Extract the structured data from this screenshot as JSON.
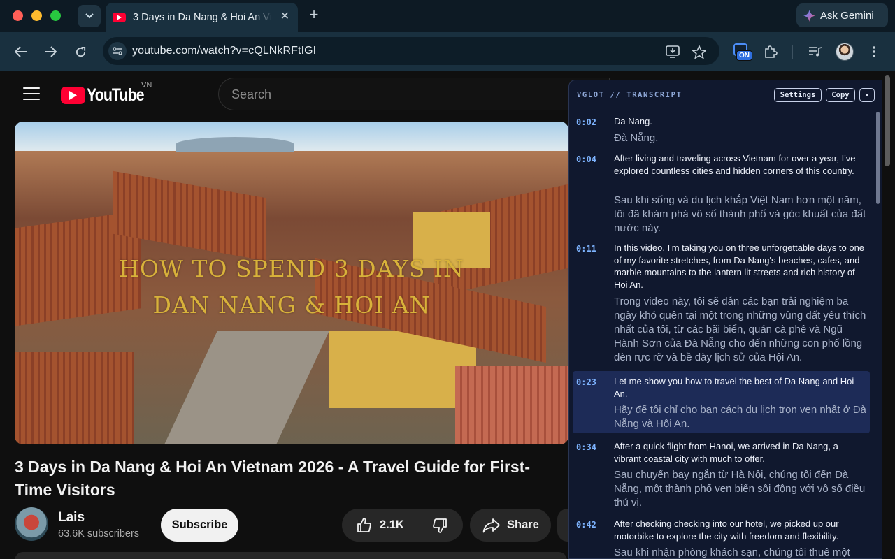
{
  "browser": {
    "tab_title": "3 Days in Da Nang & Hoi An Vietnam 2026 - A Travel Guide for First-Time Visitors",
    "url": "youtube.com/watch?v=cQLNkRFtIGI",
    "ask_gemini": "Ask Gemini",
    "extension_badge": "ON"
  },
  "youtube": {
    "logo_text": "YouTube",
    "country_code": "VN",
    "search_placeholder": "Search",
    "thumbnail_headline_line1": "HOW TO SPEND 3 DAYS IN",
    "thumbnail_headline_line2": "DAN NANG & HOI AN",
    "video_title": "3 Days in Da Nang & Hoi An Vietnam 2026 - A Travel Guide for First-Time Visitors",
    "channel_name": "Lais",
    "subscribers": "63.6K subscribers",
    "subscribe_label": "Subscribe",
    "like_count": "2.1K",
    "share_label": "Share"
  },
  "panel": {
    "title": "VGLOT // TRANSCRIPT",
    "settings_label": "Settings",
    "copy_label": "Copy",
    "close_label": "×",
    "segments": [
      {
        "ts": "0:02",
        "en": "Da Nang.",
        "vi": "Đà Nẵng."
      },
      {
        "ts": "0:04",
        "en": "After living and traveling across Vietnam for over a year, I've explored countless cities and hidden corners of this country.",
        "vi": "Sau khi sống và du lịch khắp Việt Nam hơn một năm, tôi đã khám phá vô số thành phố và góc khuất của đất nước này."
      },
      {
        "ts": "0:11",
        "en": "In this video, I'm taking you on three unforgettable days to one of my favorite stretches, from Da Nang's beaches, cafes, and marble mountains to the lantern lit streets and rich history of Hoi An.",
        "vi": "Trong video này, tôi sẽ dẫn các bạn trải nghiệm ba ngày khó quên tại một trong những vùng đất yêu thích nhất của tôi, từ các bãi biển, quán cà phê và Ngũ Hành Sơn của Đà Nẵng cho đến những con phố lồng đèn rực rỡ và bề dày lịch sử của Hội An."
      },
      {
        "ts": "0:23",
        "en": "Let me show you how to travel the best of Da Nang and Hoi An.",
        "vi": "Hãy để tôi chỉ cho bạn cách du lịch trọn vẹn nhất ở Đà Nẵng và Hội An.",
        "active": true
      },
      {
        "ts": "0:34",
        "en": "After a quick flight from Hanoi, we arrived in Da Nang, a vibrant coastal city with much to offer.",
        "vi": "Sau chuyến bay ngắn từ Hà Nội, chúng tôi đến Đà Nẵng, một thành phố ven biển sôi động với vô số điều thú vị."
      },
      {
        "ts": "0:42",
        "en": "After checking checking into our hotel, we picked up our motorbike to explore the city with freedom and flexibility.",
        "vi": "Sau khi nhận phòng khách sạn, chúng tôi thuê một"
      }
    ]
  },
  "colors": {
    "youtube_red": "#ff0033",
    "transcript_timestamp": "#7eb4ff",
    "active_segment": "#1d2b57",
    "panel_background": "#10182e"
  }
}
